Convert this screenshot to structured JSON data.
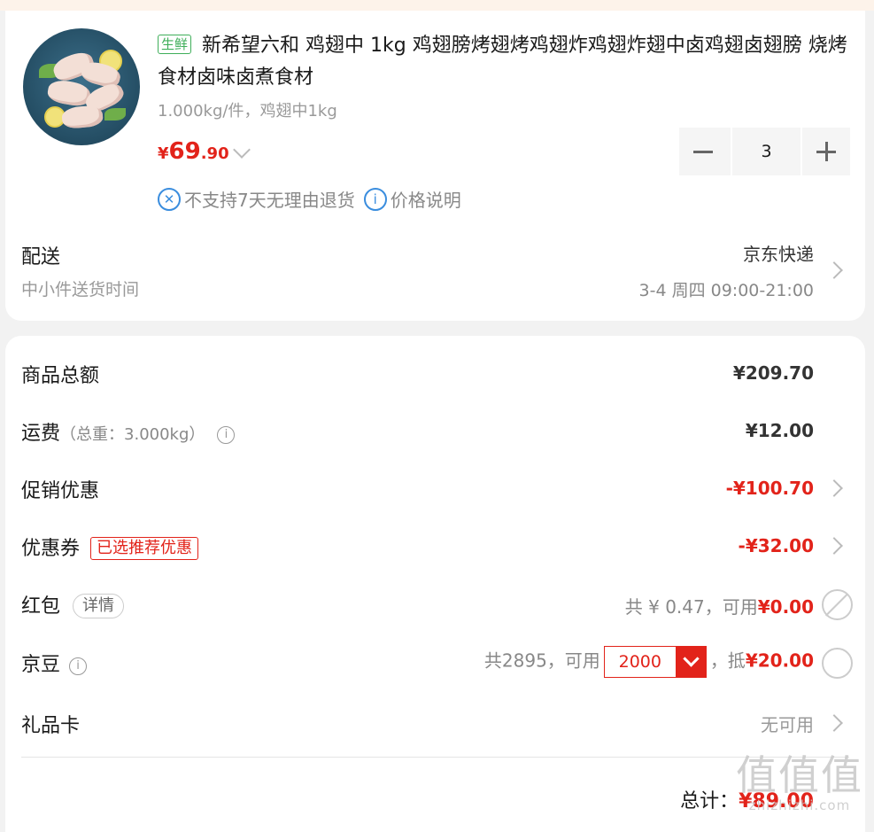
{
  "product": {
    "tag": "生鲜",
    "title": "新希望六和 鸡翅中 1kg 鸡翅膀烤翅烤鸡翅炸鸡翅炸翅中卤鸡翅卤翅膀 烧烤食材卤味卤煮食材",
    "spec": "1.000kg/件，鸡翅中1kg",
    "price_symbol": "¥",
    "price_int": "69",
    "price_dec": ".90",
    "quantity": "3",
    "no_return_note": "不支持7天无理由退货",
    "price_note": "价格说明",
    "image_icon": "chicken-wings-plate"
  },
  "delivery": {
    "label": "配送",
    "sublabel": "中小件送货时间",
    "carrier": "京东快递",
    "time": "3-4 周四 09:00-21:00"
  },
  "summary": {
    "goods_total_label": "商品总额",
    "goods_total": "¥209.70",
    "shipping_label": "运费",
    "shipping_weight": "（总重：3.000kg）",
    "shipping": "¥12.00",
    "promo_label": "促销优惠",
    "promo": "-¥100.70",
    "coupon_label": "优惠券",
    "coupon_tag": "已选推荐优惠",
    "coupon": "-¥32.00",
    "redpacket_label": "红包",
    "redpacket_detail": "详情",
    "redpacket_info_prefix": "共 ¥ 0.47，可用",
    "redpacket_avail": "¥0.00",
    "beans_label": "京豆",
    "beans_info_prefix": "共2895，可用",
    "beans_select": "2000",
    "beans_deduct_prefix": "，抵",
    "beans_deduct": "¥20.00",
    "giftcard_label": "礼品卡",
    "giftcard_status": "无可用",
    "total_label": "总计：",
    "total": "¥89.00"
  },
  "watermark": {
    "big": "值值值",
    "small": "zhizhizhi.com"
  },
  "colors": {
    "accent_red": "#e2231a",
    "fresh_green": "#3fae5a",
    "info_blue": "#3a8dde"
  }
}
